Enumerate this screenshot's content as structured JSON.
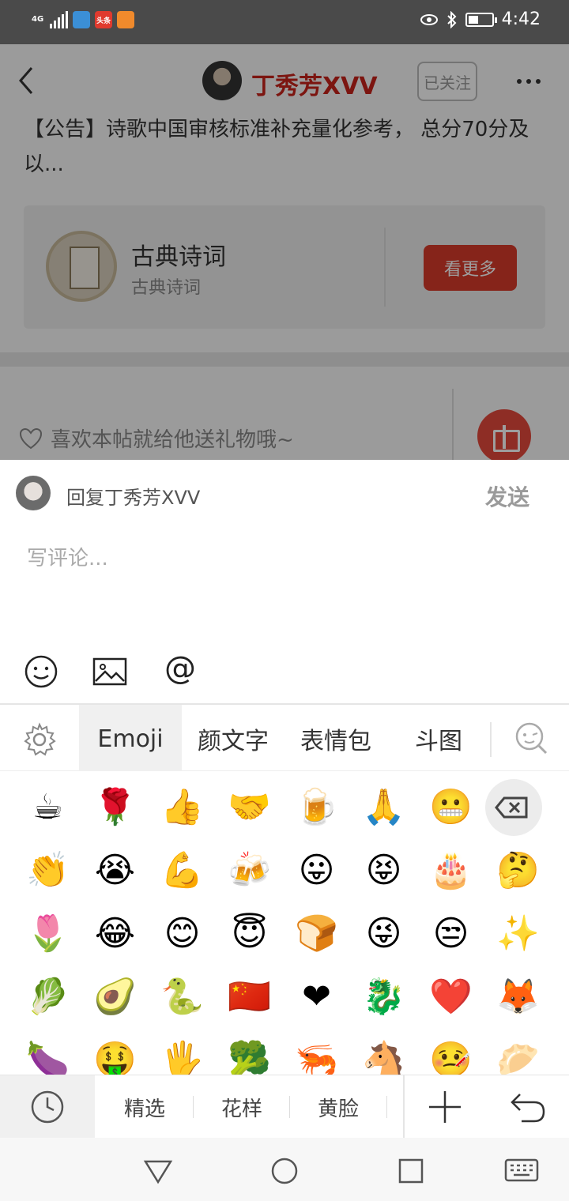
{
  "status_bar": {
    "network_label": "4G",
    "app_badge_1": "",
    "app_badge_2": "头条",
    "app_badge_3": "",
    "time": "4:42"
  },
  "post_header": {
    "author_name": "丁秀芳XVV",
    "follow_label": "已关注"
  },
  "post": {
    "notice_text": "【公告】诗歌中国审核标准补充量化参考， 总分70分及以..."
  },
  "community_card": {
    "title": "古典诗词",
    "subtitle": "古典诗词",
    "more_label": "看更多"
  },
  "gift_row": {
    "like_text": "喜欢本帖就给他送礼物哦~"
  },
  "reply": {
    "reply_to": "回复丁秀芳XVV",
    "send_label": "发送",
    "placeholder": "写评论..."
  },
  "keyboard": {
    "tabs": [
      "Emoji",
      "颜文字",
      "表情包",
      "斗图"
    ],
    "active_tab": "Emoji",
    "emoji_rows": [
      [
        "☕",
        "🌹",
        "👍",
        "🤝",
        "🍺",
        "🙏",
        "😬"
      ],
      [
        "👏",
        "😭",
        "💪",
        "🍻",
        "😛",
        "😝",
        "🎂",
        "🤔"
      ],
      [
        "🌷",
        "😂",
        "😊",
        "😇",
        "🍞",
        "😜",
        "😒",
        "✨"
      ],
      [
        "🥬",
        "🥑",
        "🐍",
        "🇨🇳",
        "❤",
        "🐉",
        "❤️",
        "🦊"
      ],
      [
        "🍆",
        "🤑",
        "🖐",
        "🥦",
        "🦐",
        "🐴",
        "🤒",
        "🥟"
      ]
    ],
    "categories": [
      "精选",
      "花样",
      "黄脸"
    ]
  },
  "colors": {
    "brand_red": "#c8231b",
    "button_red": "#d93a2b",
    "gift_red": "#e54a3d"
  }
}
